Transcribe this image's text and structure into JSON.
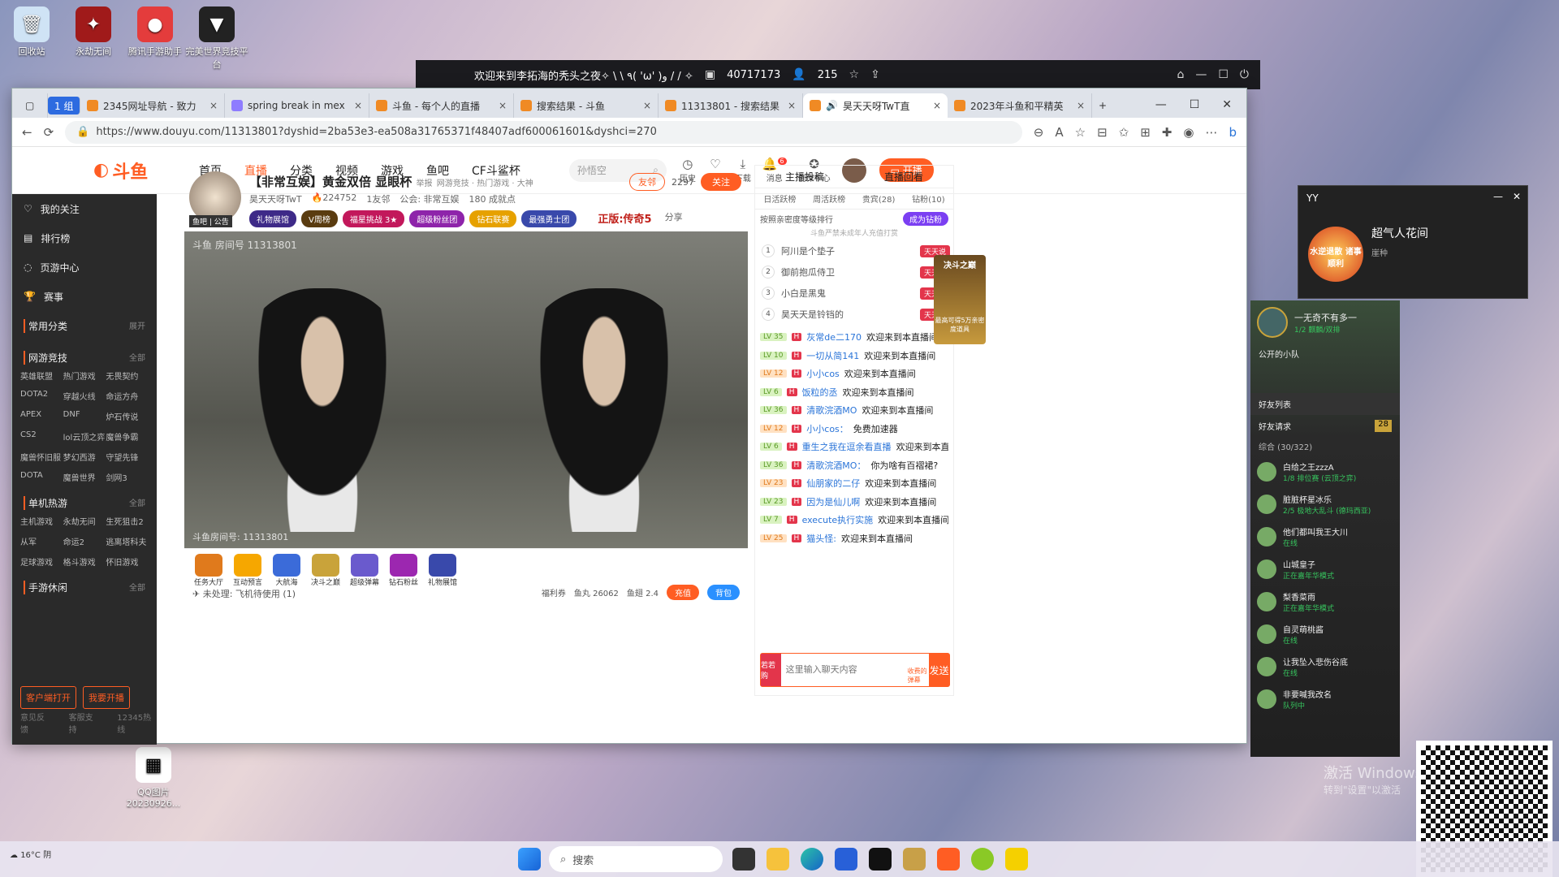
{
  "desktop": {
    "icons": [
      "回收站",
      "永劫无间",
      "腾讯手游助手",
      "完美世界竞技平台"
    ],
    "bottom_icons": [
      "QQ图片20230926..."
    ],
    "watermark": "激活 Windows",
    "watermark_sub": "转到\"设置\"以激活"
  },
  "banner": {
    "welcome": "欢迎来到李拓海的秃头之夜✧ \\ \\ ٩( 'ω' )و / / ✧",
    "hot": "40717173",
    "viewers": "215"
  },
  "browser": {
    "group": "1 组",
    "tabs": [
      "2345网址导航 - 致力",
      "spring break in mex",
      "斗鱼 - 每个人的直播",
      "搜索结果 - 斗鱼",
      "11313801 - 搜索结果",
      "昊天天呀TwT直",
      "2023年斗鱼和平精英"
    ],
    "url": "https://www.douyu.com/11313801?dyshid=2ba53e3-ea508a31765371f48407adf600061601&dyshci=270"
  },
  "douyu": {
    "logo": "斗鱼",
    "nav": [
      "首页",
      "直播",
      "分类",
      "视频",
      "游戏",
      "鱼吧",
      "CF斗鲨杯"
    ],
    "search_placeholder": "孙悟空",
    "header_icons": [
      "历史",
      "关注",
      "下载",
      "消息",
      "创作中心"
    ],
    "msg_badge": "6",
    "kaibo": "开播",
    "sidebar": {
      "items": [
        "我的关注",
        "排行榜",
        "页游中心",
        "赛事"
      ],
      "common": "常用分类",
      "expand": "展开",
      "wangyou": "网游竞技",
      "all": "全部",
      "wangyou_list": [
        "英雄联盟",
        "热门游戏",
        "无畏契约",
        "DOTA2",
        "穿越火线",
        "命运方舟",
        "APEX",
        "DNF",
        "炉石传说",
        "CS2",
        "lol云顶之弈",
        "魔兽争霸",
        "魔兽怀旧服",
        "梦幻西游",
        "守望先锋",
        "DOTA",
        "魔兽世界",
        "剑网3"
      ],
      "danji": "单机热游",
      "danji_list": [
        "主机游戏",
        "永劫无间",
        "生死狙击2",
        "从军",
        "命运2",
        "逃离塔科夫",
        "足球游戏",
        "格斗游戏",
        "怀旧游戏"
      ],
      "shouyou": "手游休闲",
      "btn_client": "客户端打开",
      "btn_live": "我要开播",
      "foot": [
        "意见反馈",
        "客服支持",
        "12345热线"
      ]
    },
    "room": {
      "title": "【非常互娱】黄金双倍 显眼杯",
      "report": "举报",
      "cats": "网游竞技 · 热门游戏 · 大神",
      "host": "昊天天呀TwT",
      "hot": "224752",
      "friends": "1友邻",
      "guild": "公会: 非常互娱",
      "age": "180 成就点",
      "share": "分享",
      "follow_btn": "关注",
      "followers": "2297",
      "friend_btn": "友邻",
      "tags": [
        "礼物展馆",
        "V周榜",
        "福星挑战 3★",
        "超级粉丝团",
        "钻石联赛",
        "最强勇士团"
      ],
      "ad": "正版:传奇5",
      "avatar_label": "鱼吧 | 公告"
    },
    "video": {
      "watermark": "斗鱼 房间号 11313801",
      "room_label": "斗鱼房间号: 11313801"
    },
    "gifts": {
      "items": [
        "任务大厅",
        "互动预言",
        "大航海",
        "决斗之巅",
        "超级弹幕",
        "钻石粉丝",
        "礼物展馆"
      ],
      "pending": "未处理: 飞机待使用 (1)",
      "welfare": "福利券",
      "yuwan": "鱼丸 26062",
      "yuchi": "鱼翅 2.4",
      "charge": "充值",
      "bag": "背包"
    },
    "chat": {
      "top": [
        "主播投稿",
        "直播回看"
      ],
      "rank_tabs": [
        "日活跃榜",
        "周活跃榜",
        "贵宾(28)",
        "钻粉(10)"
      ],
      "rank_note": "按照亲密度等级排行",
      "become_fan": "成为钻粉",
      "minor_note": "斗鱼严禁未成年人充值打赏",
      "ranks": [
        {
          "n": "1",
          "name": "阿川是个垫子",
          "tag": "天天说"
        },
        {
          "n": "2",
          "name": "御前抱瓜侍卫",
          "tag": "天天说"
        },
        {
          "n": "3",
          "name": "小白是黑鬼",
          "tag": "天天说"
        },
        {
          "n": "4",
          "name": "昊天天是铃铛的",
          "tag": "天天说"
        }
      ],
      "messages": [
        {
          "lv": "LV 35",
          "user": "灰常de二170",
          "text": "欢迎来到本直播间"
        },
        {
          "lv": "LV 10",
          "user": "一切从简141",
          "text": "欢迎来到本直播间"
        },
        {
          "lv": "LV 12",
          "user": "小小cos",
          "text": "欢迎来到本直播间"
        },
        {
          "lv": "LV 6",
          "user": "饭粒的丞",
          "text": "欢迎来到本直播间"
        },
        {
          "lv": "LV 36",
          "user": "清歌浣酒MO",
          "text": "欢迎来到本直播间"
        },
        {
          "lv": "LV 12",
          "user": "小小cos：",
          "text": "免费加速器"
        },
        {
          "lv": "LV 6",
          "user": "重生之我在逗余看直播",
          "text": "欢迎来到本直播间"
        },
        {
          "lv": "LV 36",
          "user": "清歌浣酒MO：",
          "text": "你为啥有百褶裙?"
        },
        {
          "lv": "LV 23",
          "user": "仙朋家的二仔",
          "text": "欢迎来到本直播间"
        },
        {
          "lv": "LV 23",
          "user": "因为是仙儿啊",
          "text": "欢迎来到本直播间"
        },
        {
          "lv": "LV 7",
          "user": "execute执行实施",
          "text": "欢迎来到本直播间"
        },
        {
          "lv": "LV 25",
          "user": "猫头怪:",
          "text": "欢迎来到本直播间"
        }
      ],
      "input_placeholder": "这里输入聊天内容",
      "send": "发送",
      "barrage": "收费的弹幕",
      "badge": "若若购"
    },
    "promo": {
      "title": "决斗之巅",
      "sub": "最高可得5万亲密度道具"
    }
  },
  "yy": {
    "title": "YY",
    "name": "超气人花间",
    "sub": "崖种",
    "logo": "水逆退散 诸事顺利"
  },
  "friends": {
    "title": "一无奇不有多一",
    "sub": "1/2 麒麟/双排",
    "team": "公开的小队",
    "list_title": "好友列表",
    "request": "好友请求",
    "req_count": "28",
    "group": "综合 (30/322)",
    "items": [
      {
        "name": "白给之王zzzA",
        "st": "1/8 排位赛 (云顶之弈)"
      },
      {
        "name": "脏脏杯星冰乐",
        "st": "2/5 极地大乱斗 (德玛西亚)"
      },
      {
        "name": "他们都叫我王大川",
        "st": "在线"
      },
      {
        "name": "山城皇子",
        "st": "正在嘉年华模式"
      },
      {
        "name": "梨香菜雨",
        "st": "正在嘉年华模式"
      },
      {
        "name": "自灵萌桃酱",
        "st": "在线"
      },
      {
        "name": "让我坠入悲伤谷底",
        "st": "在线"
      },
      {
        "name": "非要喊我改名",
        "st": "队列中"
      }
    ]
  },
  "taskbar": {
    "search": "搜索",
    "temp": "16°C",
    "weather": "阴"
  }
}
